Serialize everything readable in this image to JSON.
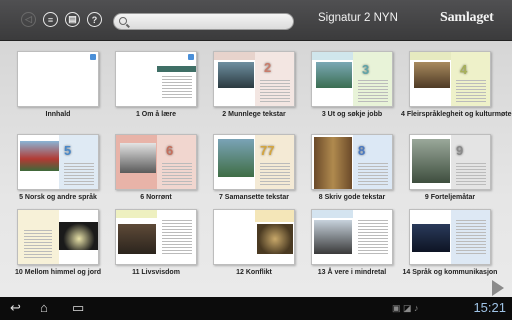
{
  "header": {
    "title": "Signatur 2 NYN",
    "brand": "Samlaget",
    "search_placeholder": "",
    "icons": [
      "back-icon",
      "list-icon",
      "bookmarks-icon",
      "help-icon"
    ]
  },
  "chapters": [
    {
      "label": "Innhald"
    },
    {
      "label": "1 Om å lære"
    },
    {
      "label": "2 Munnlege tekstar"
    },
    {
      "label": "3 Ut og søkje jobb"
    },
    {
      "label": "4 Fleirspråklegheit og kulturmøte"
    },
    {
      "label": "5 Norsk og andre språk"
    },
    {
      "label": "6 Norrønt"
    },
    {
      "label": "7 Samansette tekstar"
    },
    {
      "label": "8 Skriv gode tekstar"
    },
    {
      "label": "9 Forteljemåtar"
    },
    {
      "label": "10 Mellom himmel og jord"
    },
    {
      "label": "11 Livsvisdom"
    },
    {
      "label": "12 Konflikt"
    },
    {
      "label": "13 Å vere i mindretal"
    },
    {
      "label": "14 Språk og kommunikasjon"
    }
  ],
  "thumb_numbers": {
    "t2": "2",
    "t3": "3",
    "t4": "4",
    "t5": "5",
    "t6": "6",
    "t7": "77",
    "t8": "8",
    "t9": "9"
  },
  "statusbar": {
    "time": "15:21"
  },
  "colors": {
    "topbar": "#3e3e40",
    "accent_blue": "#4a8fd8",
    "clock": "#9fc3e6"
  }
}
